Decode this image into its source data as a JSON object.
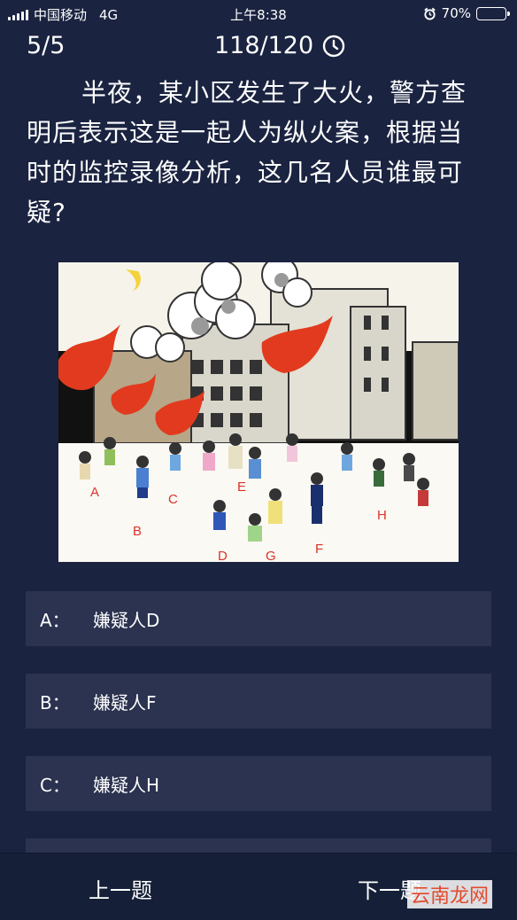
{
  "status": {
    "carrier": "中国移动",
    "network": "4G",
    "time": "上午8:38",
    "battery": "70%",
    "battery_level": 0.7
  },
  "header": {
    "progress": "5/5",
    "timer": "118/120"
  },
  "question": {
    "text": "半夜，某小区发生了大火，警方查明后表示这是一起人为纵火案，根据当时的监控录像分析，这几名人员谁最可疑?"
  },
  "image": {
    "labels": [
      "A",
      "B",
      "C",
      "D",
      "E",
      "F",
      "G",
      "H"
    ]
  },
  "options": [
    {
      "letter": "A：",
      "text": "嫌疑人D"
    },
    {
      "letter": "B：",
      "text": "嫌疑人F"
    },
    {
      "letter": "C：",
      "text": "嫌疑人H"
    }
  ],
  "footer": {
    "prev": "上一题",
    "next": "下一题",
    "watermark": "云南龙网"
  }
}
